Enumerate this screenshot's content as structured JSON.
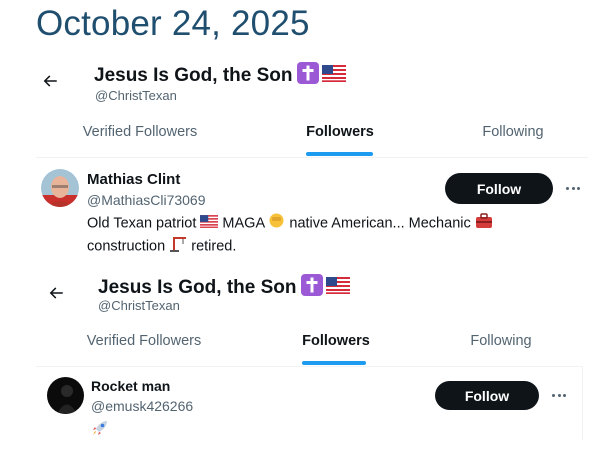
{
  "date": "October 24, 2025",
  "panels": [
    {
      "profile_title": "Jesus Is God, the Son",
      "profile_handle": "@ChristTexan",
      "tabs": [
        "Verified Followers",
        "Followers",
        "Following"
      ],
      "active_tab": "Followers",
      "user": {
        "name": "Mathias Clint",
        "handle": "@MathiasCli73069",
        "bio_line1_a": "Old Texan patriot",
        "bio_line1_b": "MAGA",
        "bio_line1_c": "native American... Mechanic",
        "bio_line2_a": "construction",
        "bio_line2_b": "retired.",
        "follow_label": "Follow"
      }
    },
    {
      "profile_title": "Jesus Is God, the Son",
      "profile_handle": "@ChristTexan",
      "tabs": [
        "Verified Followers",
        "Followers",
        "Following"
      ],
      "active_tab": "Followers",
      "user": {
        "name": "Rocket man",
        "handle": "@emusk426266",
        "follow_label": "Follow"
      }
    }
  ],
  "icons": {
    "back": "arrow-left-icon",
    "cross": "latin-cross-emoji",
    "flag": "us-flag-emoji",
    "fist": "raised-fist-emoji",
    "toolbox": "toolbox-emoji",
    "crane": "construction-crane-emoji",
    "rocket": "rocket-emoji",
    "more": "more-horizontal-icon"
  },
  "colors": {
    "date": "#1f4e6e",
    "accent": "#1d9bf0",
    "follow_bg": "#0f1419",
    "secondary_text": "#536471"
  }
}
